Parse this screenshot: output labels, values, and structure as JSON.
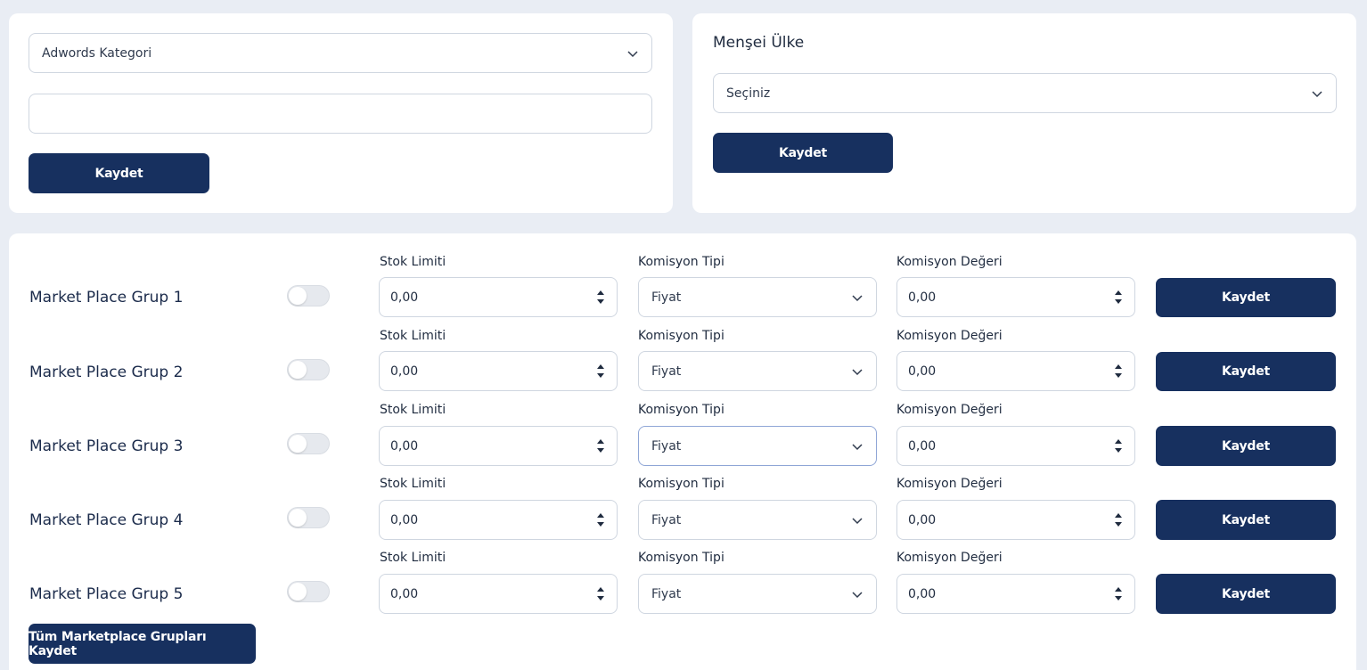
{
  "top_left": {
    "category_select": {
      "value": "Adwords Kategori",
      "icon": "chevron-down-icon"
    },
    "text_input": {
      "value": ""
    },
    "save_label": "Kaydet"
  },
  "top_right": {
    "title": "Menşei Ülke",
    "country_select": {
      "value": "Seçiniz",
      "icon": "chevron-down-icon"
    },
    "save_label": "Kaydet"
  },
  "groups": [
    {
      "name": "Market Place Grup 1",
      "stock_label": "Stok Limiti",
      "stock_value": "0,00",
      "commission_type_label": "Komisyon Tipi",
      "commission_type_value": "Fiyat",
      "commission_value_label": "Komisyon Değeri",
      "commission_value": "0,00",
      "save_label": "Kaydet",
      "enabled": false
    },
    {
      "name": "Market Place Grup 2",
      "stock_label": "Stok Limiti",
      "stock_value": "0,00",
      "commission_type_label": "Komisyon Tipi",
      "commission_type_value": "Fiyat",
      "commission_value_label": "Komisyon Değeri",
      "commission_value": "0,00",
      "save_label": "Kaydet",
      "enabled": false
    },
    {
      "name": "Market Place Grup 3",
      "stock_label": "Stok Limiti",
      "stock_value": "0,00",
      "commission_type_label": "Komisyon Tipi",
      "commission_type_value": "Fiyat",
      "commission_value_label": "Komisyon Değeri",
      "commission_value": "0,00",
      "save_label": "Kaydet",
      "enabled": false
    },
    {
      "name": "Market Place Grup 4",
      "stock_label": "Stok Limiti",
      "stock_value": "0,00",
      "commission_type_label": "Komisyon Tipi",
      "commission_type_value": "Fiyat",
      "commission_value_label": "Komisyon Değeri",
      "commission_value": "0,00",
      "save_label": "Kaydet",
      "enabled": false
    },
    {
      "name": "Market Place Grup 5",
      "stock_label": "Stok Limiti",
      "stock_value": "0,00",
      "commission_type_label": "Komisyon Tipi",
      "commission_type_value": "Fiyat",
      "commission_value_label": "Komisyon Değeri",
      "commission_value": "0,00",
      "save_label": "Kaydet",
      "enabled": false
    }
  ],
  "save_all_label": "Tüm Marketplace Grupları Kaydet",
  "colors": {
    "primary": "#17305f",
    "background": "#e9edf4",
    "card": "#ffffff",
    "border": "#cfd6e0"
  }
}
